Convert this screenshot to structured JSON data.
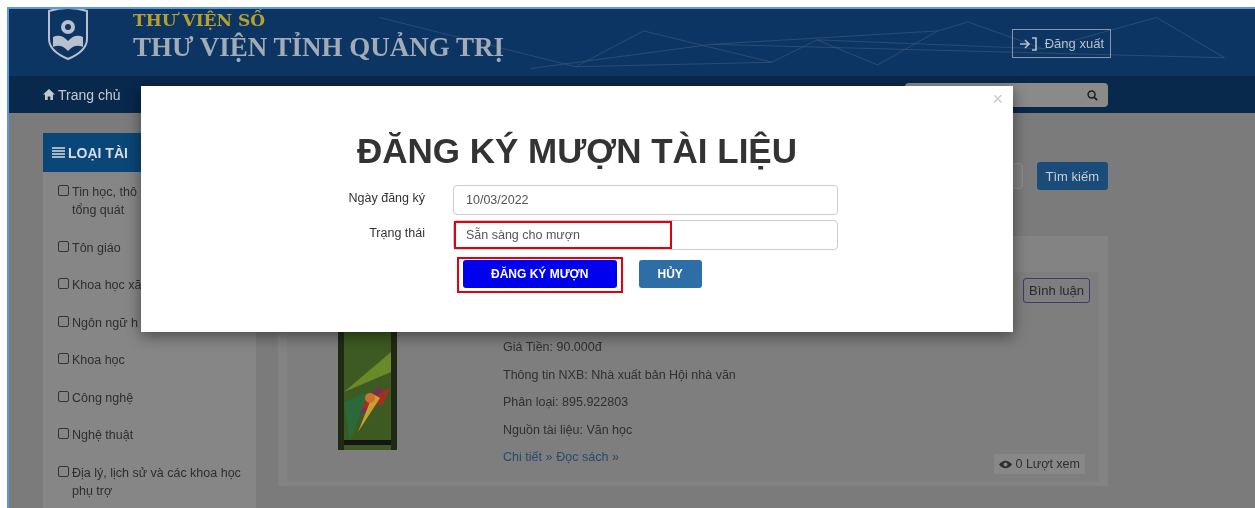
{
  "header": {
    "subtitle": "THƯ VIỆN SỐ",
    "title": "THƯ VIỆN TỈNH QUẢNG TRỊ",
    "logout": "Đăng xuất"
  },
  "nav": {
    "home": "Trang chủ"
  },
  "sidebar": {
    "title": "LOẠI TÀI",
    "items": [
      {
        "lines": [
          "Tin học, thô",
          "tổng quát"
        ],
        "checked": false
      },
      {
        "lines": [
          "Tôn giáo"
        ],
        "checked": false
      },
      {
        "lines": [
          "Khoa học xã"
        ],
        "checked": false
      },
      {
        "lines": [
          "Ngôn ngữ h"
        ],
        "checked": false
      },
      {
        "lines": [
          "Khoa học"
        ],
        "checked": false
      },
      {
        "lines": [
          "Công nghệ"
        ],
        "checked": false
      },
      {
        "lines": [
          "Nghệ thuật"
        ],
        "checked": false
      },
      {
        "lines": [
          "Địa lý, lịch sử và các khoa học phụ trợ"
        ],
        "checked": false
      }
    ]
  },
  "search_button": "Tìm kiếm",
  "book": {
    "actions": [
      "Bình luận"
    ],
    "cover": {
      "kind": "picture"
    },
    "details": [
      "Giá Tiền: 90.000đ",
      "Thông tin NXB: Nhà xuất bản Hội nhà văn",
      "Phân loại: 895.922803",
      "Nguồn tài liệu: Văn học"
    ],
    "links": [
      "Chi tiết »",
      "Đọc sách »"
    ],
    "views": "0 Lượt xem"
  },
  "modal": {
    "close": "×",
    "title": "ĐĂNG KÝ MƯỢN TÀI LIỆU",
    "fields": [
      {
        "label": "Ngày đăng ký",
        "value": "10/03/2022",
        "highlighted": false
      },
      {
        "label": "Trạng thái",
        "value": "Sẵn sàng cho mượn",
        "highlighted": true
      }
    ],
    "buttons": [
      {
        "label": "ĐĂNG KÝ MƯỢN",
        "kind": "primary",
        "highlighted": true
      },
      {
        "label": "HỦY",
        "kind": "cancel",
        "highlighted": false
      }
    ]
  }
}
